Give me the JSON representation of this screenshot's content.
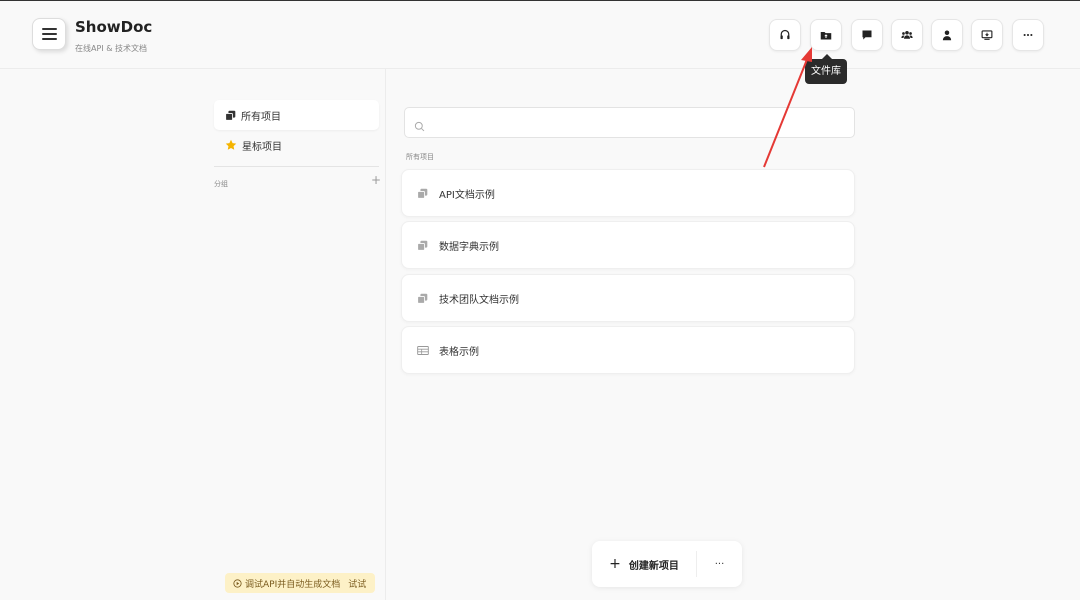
{
  "app": {
    "title": "ShowDoc",
    "subtitle": "在线API & 技术文档"
  },
  "toolbar": {
    "buttons": [
      {
        "name": "headset-icon"
      },
      {
        "name": "folder-upload-icon"
      },
      {
        "name": "chat-icon"
      },
      {
        "name": "team-icon"
      },
      {
        "name": "user-icon"
      },
      {
        "name": "monitor-icon"
      },
      {
        "name": "more-icon"
      }
    ],
    "tooltip": "文件库"
  },
  "sidebar": {
    "items": [
      {
        "label": "所有项目",
        "icon": "stack-icon",
        "active": true
      },
      {
        "label": "星标项目",
        "icon": "star-icon",
        "active": false
      }
    ],
    "group_label": "分组",
    "group_add": "+",
    "promo_text": "调试API并自动生成文档",
    "promo_link": "试试"
  },
  "main": {
    "search_placeholder": "",
    "section_label": "所有项目",
    "projects": [
      {
        "name": "API文档示例",
        "icon": "stack-icon"
      },
      {
        "name": "数据字典示例",
        "icon": "stack-icon"
      },
      {
        "name": "技术团队文档示例",
        "icon": "stack-icon"
      },
      {
        "name": "表格示例",
        "icon": "table-icon"
      }
    ]
  },
  "bottom_bar": {
    "create_label": "创建新项目",
    "more_label": "···"
  },
  "colors": {
    "background": "#f9f9f9",
    "annotation_arrow": "#e53935",
    "star": "#f5b400",
    "promo_bg": "#fdf1c7"
  }
}
